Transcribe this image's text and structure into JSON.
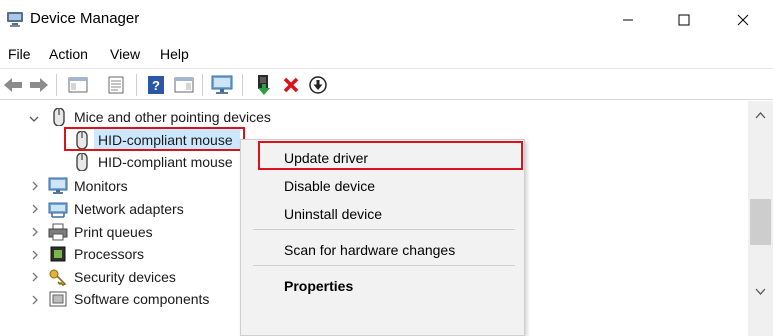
{
  "window": {
    "title": "Device Manager"
  },
  "menu": [
    "File",
    "Action",
    "View",
    "Help"
  ],
  "toolbar": {
    "icons": [
      "back-icon",
      "forward-icon",
      "properties-view-icon",
      "console-tree-icon",
      "help-icon",
      "action-pane-icon",
      "scan-monitor-icon",
      "update-driver-icon",
      "uninstall-icon",
      "download-icon"
    ]
  },
  "tree": {
    "category": "Mice and other pointing devices",
    "devices": [
      "HID-compliant mouse",
      "HID-compliant mouse"
    ],
    "other_categories": [
      "Monitors",
      "Network adapters",
      "Print queues",
      "Processors",
      "Security devices",
      "Software components"
    ]
  },
  "context_menu": {
    "items": [
      "Update driver",
      "Disable device",
      "Uninstall device",
      "Scan for hardware changes",
      "Properties"
    ]
  },
  "colors": {
    "highlight_border": "#d9131b",
    "selection": "#cce8ff"
  }
}
